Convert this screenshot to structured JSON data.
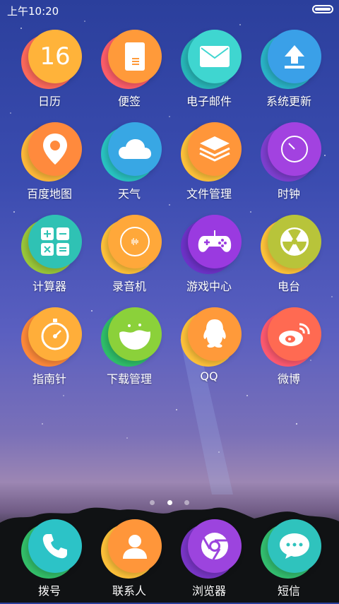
{
  "status_bar": {
    "time": "上午10:20"
  },
  "apps": [
    {
      "label": "日历",
      "icon": "calendar-icon",
      "number": "16",
      "back": "#ff6a5c",
      "front": "#ffb33a"
    },
    {
      "label": "便签",
      "icon": "notes-icon",
      "back": "#ff5e6a",
      "front": "#ff9a3a"
    },
    {
      "label": "电子邮件",
      "icon": "mail-icon",
      "back": "#28b7b9",
      "front": "#3fd6d0"
    },
    {
      "label": "系统更新",
      "icon": "upload-icon",
      "back": "#2ab4c8",
      "front": "#3aa0e8"
    },
    {
      "label": "百度地图",
      "icon": "map-pin-icon",
      "back": "#ffb93a",
      "front": "#ff8a3d"
    },
    {
      "label": "天气",
      "icon": "cloud-icon",
      "back": "#29c4c2",
      "front": "#38a7e4"
    },
    {
      "label": "文件管理",
      "icon": "layers-icon",
      "back": "#ffc23a",
      "front": "#ff963a"
    },
    {
      "label": "时钟",
      "icon": "clock-icon",
      "back": "#7e3fd0",
      "front": "#a242e0"
    },
    {
      "label": "计算器",
      "icon": "calculator-icon",
      "back": "#9ac83a",
      "front": "#2fc2b4"
    },
    {
      "label": "录音机",
      "icon": "recorder-icon",
      "back": "#ffc23a",
      "front": "#ffa83a"
    },
    {
      "label": "游戏中心",
      "icon": "gamepad-icon",
      "back": "#6d32c8",
      "front": "#9a3ae0"
    },
    {
      "label": "电台",
      "icon": "radio-icon",
      "back": "#ffc43a",
      "front": "#b8c43a"
    },
    {
      "label": "指南针",
      "icon": "compass-icon",
      "back": "#ff8a3a",
      "front": "#ffae3a"
    },
    {
      "label": "下载管理",
      "icon": "download-icon",
      "back": "#2fbf6a",
      "front": "#8bd13a"
    },
    {
      "label": "QQ",
      "icon": "qq-penguin-icon",
      "back": "#ffc23a",
      "front": "#ff9a3a"
    },
    {
      "label": "微博",
      "icon": "weibo-icon",
      "back": "#ff5a70",
      "front": "#ff6a52"
    }
  ],
  "dock": [
    {
      "label": "拨号",
      "icon": "phone-icon",
      "back": "#33c06a",
      "front": "#2cc3c7"
    },
    {
      "label": "联系人",
      "icon": "contact-icon",
      "back": "#ffc23a",
      "front": "#ff963a"
    },
    {
      "label": "浏览器",
      "icon": "browser-icon",
      "back": "#7a36c8",
      "front": "#9c44de"
    },
    {
      "label": "短信",
      "icon": "message-icon",
      "back": "#33bf70",
      "front": "#2fc3bd"
    }
  ],
  "page_indicator": {
    "count": 3,
    "active": 2
  }
}
